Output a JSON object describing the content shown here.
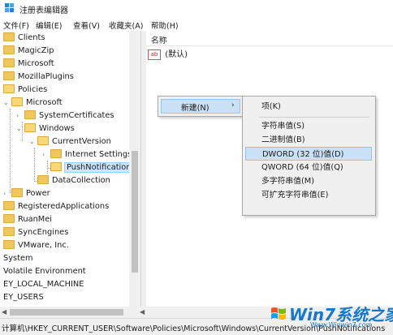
{
  "window": {
    "title": "注册表编辑器"
  },
  "menu": {
    "items": [
      "文件(F)",
      "编辑(E)",
      "查看(V)",
      "收藏夹(A)",
      "帮助(H)"
    ]
  },
  "tree": {
    "nodes": [
      "Clients",
      "MagicZip",
      "Microsoft",
      "MozillaPlugins",
      "Policies",
      "Microsoft",
      "SystemCertificates",
      "Windows",
      "CurrentVersion",
      "Internet Settings",
      "PushNotifications",
      "DataCollection",
      "Power",
      "RegisteredApplications",
      "RuanMei",
      "SyncEngines",
      "VMware, Inc.",
      "System",
      "Volatile Environment",
      "EY_LOCAL_MACHINE",
      "EY_USERS"
    ],
    "selected": "PushNotifications"
  },
  "list": {
    "column_name": "名称",
    "rows": [
      {
        "icon": "ab",
        "name": "(默认)"
      }
    ]
  },
  "context_menu": {
    "new_label": "新建(N)",
    "arrow": "›"
  },
  "submenu": {
    "items": [
      "项(K)",
      "字符串值(S)",
      "二进制值(B)",
      "DWORD (32 位)值(D)",
      "QWORD (64 位)值(Q)",
      "多字符串值(M)",
      "可扩充字符串值(E)"
    ],
    "highlighted": "DWORD (32 位)值(D)"
  },
  "status": {
    "path": "计算机\\HKEY_CURRENT_USER\\Software\\Policies\\Microsoft\\Windows\\CurrentVersion\\PushNotifications"
  },
  "watermark": {
    "brand": "Win7系统之家",
    "url": "Www.Winwin7.com"
  }
}
